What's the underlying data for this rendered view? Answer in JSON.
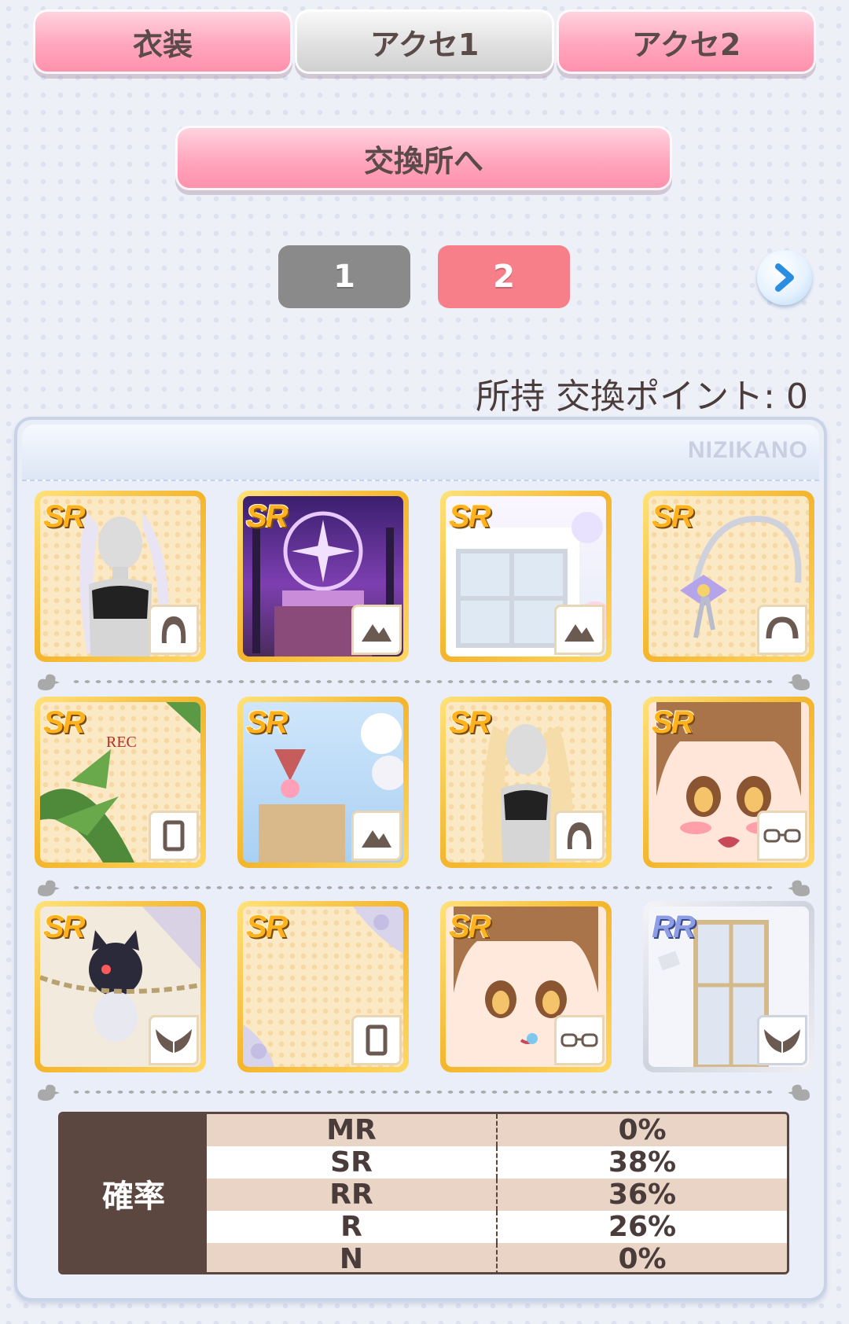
{
  "tabs": [
    {
      "label": "衣装",
      "state": "active"
    },
    {
      "label": "アクセ1",
      "state": "inactive"
    },
    {
      "label": "アクセ2",
      "state": "active"
    }
  ],
  "exchange_button": {
    "label": "交換所へ"
  },
  "pagination": {
    "pages": [
      "1",
      "2"
    ],
    "current": "2",
    "next_icon": "chevron-right-icon"
  },
  "points": {
    "label": "所持 交換ポイント",
    "separator": ":",
    "value": "0"
  },
  "panel": {
    "watermark": "NIZIKANO"
  },
  "items": [
    {
      "rarity": "SR",
      "type_icon": "hair-icon"
    },
    {
      "rarity": "SR",
      "type_icon": "background-icon"
    },
    {
      "rarity": "SR",
      "type_icon": "background-icon"
    },
    {
      "rarity": "SR",
      "type_icon": "headband-icon"
    },
    {
      "rarity": "SR",
      "type_icon": "frame-icon",
      "caption": "REC"
    },
    {
      "rarity": "SR",
      "type_icon": "background-icon"
    },
    {
      "rarity": "SR",
      "type_icon": "hair-icon"
    },
    {
      "rarity": "SR",
      "type_icon": "glasses-icon"
    },
    {
      "rarity": "SR",
      "type_icon": "wings-icon"
    },
    {
      "rarity": "SR",
      "type_icon": "frame-icon"
    },
    {
      "rarity": "SR",
      "type_icon": "glasses-icon"
    },
    {
      "rarity": "RR",
      "type_icon": "wings-icon"
    }
  ],
  "probability": {
    "header": "確率",
    "rows": [
      {
        "rank": "MR",
        "value": "0%"
      },
      {
        "rank": "SR",
        "value": "38%"
      },
      {
        "rank": "RR",
        "value": "36%"
      },
      {
        "rank": "R",
        "value": "26%"
      },
      {
        "rank": "N",
        "value": "0%"
      }
    ]
  },
  "colors": {
    "accent_pink": "#ff8fab",
    "page_active": "#f77f8a",
    "page_inactive": "#8a8a8a",
    "table_dark": "#5c4640"
  }
}
